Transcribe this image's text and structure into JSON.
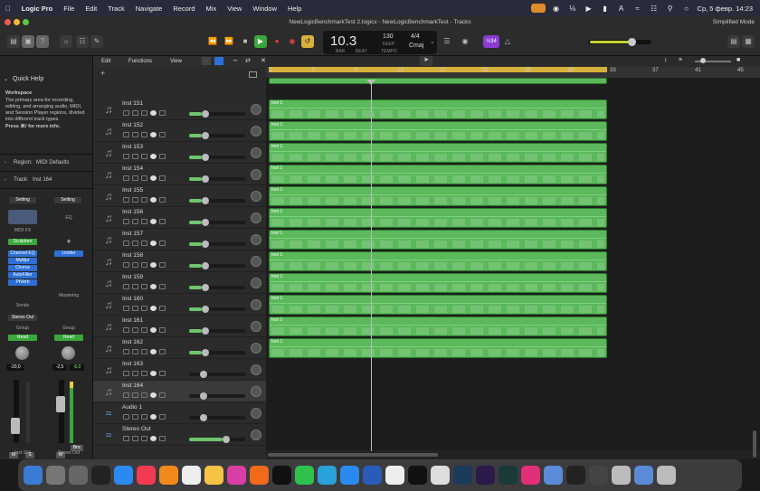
{
  "menubar": {
    "app_name": "Logic Pro",
    "items": [
      "File",
      "Edit",
      "Track",
      "Navigate",
      "Record",
      "Mix",
      "View",
      "Window",
      "Help"
    ],
    "datetime": "Ср, 5 февр.  14:23"
  },
  "window": {
    "title": "NewLogicBenchmarkTest 2.logicx - NewLogicBenchmarkTest - Tracks",
    "simplified_mode": "Simplified Mode"
  },
  "lcd": {
    "position": "10.3",
    "bar_label": "BAR",
    "beat_label": "BEAT",
    "tempo": "130",
    "keep_label": "KEEP",
    "tempo_label": "TEMPO",
    "signature": "4/4",
    "key": "Cmaj"
  },
  "toolbar": {
    "cpu_badge": "½34"
  },
  "inspector": {
    "quick_help_title": "Quick Help",
    "help_heading": "Workspace",
    "help_text": "The primary area for recording, editing, and arranging audio, MIDI, and Session Player regions, divided into different track types.",
    "help_more": "Press ⌘/ for more info.",
    "region_label": "Region:",
    "region_value": "MIDI Defaults",
    "track_label": "Track:",
    "track_value": "Inst 164",
    "setting_1": "Setting",
    "setting_2": "Setting",
    "midi_fx": "MIDI FX",
    "eq": "EQ",
    "instrument": "Sculpture",
    "plugins": [
      "Channel EQ",
      "Multipr",
      "Chorus",
      "AutoFilter",
      "PtVerb"
    ],
    "limiter": "Limiter",
    "mastering": "Mastering",
    "sends": "Sends",
    "output": "Stereo Out",
    "group_1": "Group",
    "group_2": "Group",
    "read_1": "Read",
    "read_2": "Read",
    "vol_1": "-20,0",
    "vol_2": "-2,5",
    "vol_2b": "-5,0",
    "m_label": "M",
    "s_label": "S",
    "bnc_label": "Bnc",
    "strip1_name": "Inst 164",
    "strip2_name": "Stereo Out"
  },
  "tracks_header": {
    "edit": "Edit",
    "functions": "Functions",
    "view": "View"
  },
  "ruler": {
    "ticks": [
      "1",
      "5",
      "9",
      "13",
      "17",
      "21",
      "25",
      "29",
      "33",
      "37",
      "41",
      "45"
    ]
  },
  "tracks": [
    {
      "name": "Inst 151",
      "fill": 0.22
    },
    {
      "name": "Inst 152",
      "fill": 0.22
    },
    {
      "name": "Inst 153",
      "fill": 0.22
    },
    {
      "name": "Inst 154",
      "fill": 0.22
    },
    {
      "name": "Inst 155",
      "fill": 0.22
    },
    {
      "name": "Inst 156",
      "fill": 0.22
    },
    {
      "name": "Inst 157",
      "fill": 0.22
    },
    {
      "name": "Inst 158",
      "fill": 0.22
    },
    {
      "name": "Inst 159",
      "fill": 0.22
    },
    {
      "name": "Inst 160",
      "fill": 0.22
    },
    {
      "name": "Inst 161",
      "fill": 0.22
    },
    {
      "name": "Inst 162",
      "fill": 0.22
    },
    {
      "name": "Inst 163",
      "fill": 0.0
    },
    {
      "name": "Inst 164",
      "fill": 0.0
    },
    {
      "name": "Audio 1",
      "fill": 0.0
    },
    {
      "name": "Stereo Out",
      "fill": 0.6
    }
  ],
  "region_name": "Inst 1",
  "dock": {
    "apps": [
      "Finder",
      "Settings",
      "Calculator",
      "Terminal",
      "App Store",
      "Music",
      "VLC",
      "TextEdit",
      "Photos",
      "Shortcuts",
      "Firefox",
      "ChatGPT",
      "WhatsApp",
      "Telegram",
      "Safari",
      "Word",
      "Chrome",
      "Notion",
      "OpenAI",
      "Photoshop",
      "Premiere",
      "Audition",
      "Creative Cloud",
      "Logic",
      "Terminal",
      "Unity",
      "Steam",
      "Downloads",
      "Trash"
    ]
  },
  "colors": {
    "region_green": "#5bb85b",
    "cycle_yellow": "#d7b23b",
    "accent_blue": "#2d6fd6"
  }
}
